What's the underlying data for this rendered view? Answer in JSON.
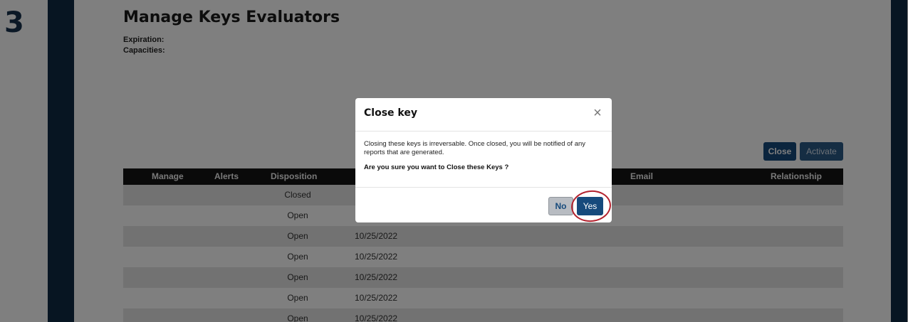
{
  "step": {
    "number": "3"
  },
  "page": {
    "title": "Manage Keys Evaluators",
    "expiration_label": "Expiration:",
    "capacities_label": "Capacities:"
  },
  "actions": {
    "close_label": "Close",
    "activate_label": "Activate"
  },
  "table": {
    "headers": {
      "manage": "Manage",
      "alerts": "Alerts",
      "disposition": "Disposition",
      "email": "Email",
      "relationship": "Relationship"
    },
    "rows": [
      {
        "disposition": "Closed",
        "date": ""
      },
      {
        "disposition": "Open",
        "date": ""
      },
      {
        "disposition": "Open",
        "date": "10/25/2022"
      },
      {
        "disposition": "Open",
        "date": "10/25/2022"
      },
      {
        "disposition": "Open",
        "date": "10/25/2022"
      },
      {
        "disposition": "Open",
        "date": "10/25/2022"
      },
      {
        "disposition": "Open",
        "date": "10/25/2022"
      }
    ]
  },
  "modal": {
    "title": "Close key",
    "close_icon": "×",
    "message": "Closing these keys is irreversable. Once closed, you will be notified of any reports that are generated.",
    "question": "Are you sure you want to Close these Keys ?",
    "no_label": "No",
    "yes_label": "Yes"
  },
  "colors": {
    "frame": "#0f2a45",
    "primary_button": "#164a7c",
    "table_header": "#141414",
    "highlight": "#b3232f"
  }
}
